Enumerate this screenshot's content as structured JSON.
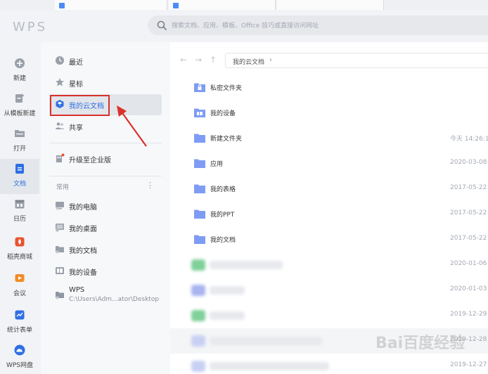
{
  "app": {
    "logo": "WPS",
    "search_placeholder": "搜索文档、应用、模板、Office 技巧或直接访问网址"
  },
  "rail": [
    {
      "label": "新建",
      "icon": "plus-circle-icon"
    },
    {
      "label": "从模板新建",
      "icon": "template-icon"
    },
    {
      "label": "打开",
      "icon": "folder-open-icon"
    },
    {
      "label": "文档",
      "icon": "document-icon",
      "active": true
    },
    {
      "label": "日历",
      "icon": "calendar-icon"
    },
    {
      "label": "稻壳商城",
      "icon": "docer-store-icon"
    },
    {
      "label": "会议",
      "icon": "meeting-icon"
    },
    {
      "label": "统计表单",
      "icon": "form-icon"
    },
    {
      "label": "WPS网盘",
      "icon": "cloud-disk-icon"
    }
  ],
  "nav": {
    "items": [
      {
        "label": "最近",
        "icon": "clock-icon"
      },
      {
        "label": "星标",
        "icon": "star-icon"
      },
      {
        "label": "我的云文档",
        "icon": "cloud-doc-icon",
        "selected": true
      },
      {
        "label": "共享",
        "icon": "people-icon"
      }
    ],
    "upgrade": {
      "label": "升级至企业版",
      "icon": "upgrade-icon"
    },
    "section_title": "常用",
    "section_more": "⋮",
    "common": [
      {
        "label": "我的电脑",
        "icon": "computer-icon"
      },
      {
        "label": "我的桌面",
        "icon": "desktop-icon"
      },
      {
        "label": "我的文档",
        "icon": "my-docs-icon"
      },
      {
        "label": "我的设备",
        "icon": "device-icon"
      }
    ],
    "wps_folder": {
      "label": "WPS",
      "path": "C:\\Users\\Adm...ator\\Desktop",
      "icon": "folder-icon"
    }
  },
  "toolbar": {
    "back": "←",
    "forward": "→",
    "up": "↑",
    "breadcrumb": "我的云文档",
    "breadcrumb_chevron": "›"
  },
  "files": [
    {
      "name": "私密文件夹",
      "date": "",
      "icon": "lock-folder-icon"
    },
    {
      "name": "我的设备",
      "date": "",
      "icon": "device-folder-icon"
    },
    {
      "name": "新建文件夹",
      "date": "今天 14:26:1",
      "icon": "folder-icon"
    },
    {
      "name": "应用",
      "date": "2020-03-08",
      "icon": "folder-icon"
    },
    {
      "name": "我的表格",
      "date": "2017-05-22",
      "icon": "folder-icon"
    },
    {
      "name": "我的PPT",
      "date": "2017-05-22",
      "icon": "folder-icon"
    },
    {
      "name": "我的文档",
      "date": "2017-05-22",
      "icon": "folder-icon"
    }
  ],
  "blurred_files": [
    {
      "date": "2020-01-06"
    },
    {
      "date": "2020-01-03"
    },
    {
      "date": "2019-12-29"
    },
    {
      "date": "2019-12-28"
    },
    {
      "date": "2019-12-27"
    }
  ],
  "watermark": "Bai百度经验",
  "colors": {
    "accent": "#2f6fe4",
    "folder": "#7f9cf5",
    "highlight": "#d9312b"
  }
}
